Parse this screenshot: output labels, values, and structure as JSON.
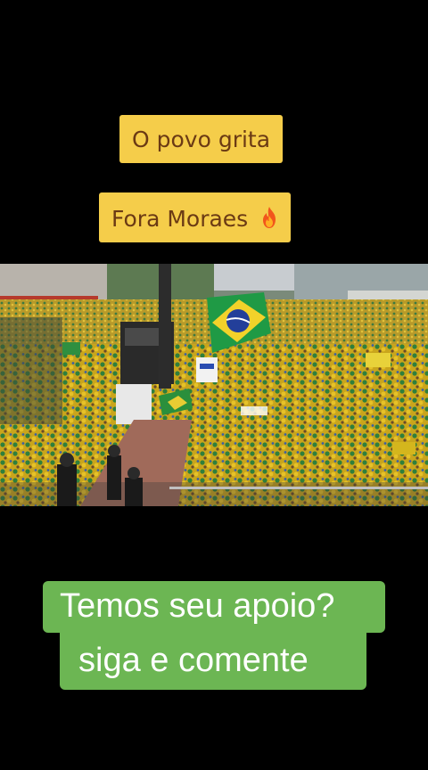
{
  "captions": {
    "line1": "O povo grita",
    "line2": "Fora Moraes"
  },
  "cta": {
    "line1": "Temos seu apoio?",
    "line2": "siga e comente"
  },
  "icons": {
    "caption_emoji": "fire-icon"
  },
  "colors": {
    "background": "#000000",
    "caption_bg": "#f5cd4a",
    "caption_text": "#6b3a14",
    "cta_bg": "#6cb653",
    "cta_text": "#ffffff"
  }
}
